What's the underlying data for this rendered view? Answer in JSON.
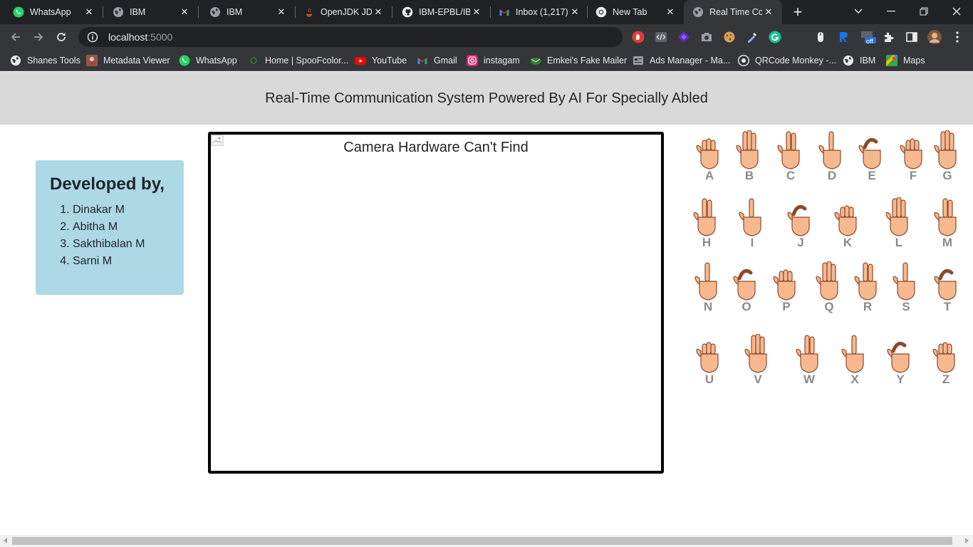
{
  "browser": {
    "tabs": [
      {
        "title": "WhatsApp",
        "icon": "whatsapp-icon"
      },
      {
        "title": "IBM",
        "icon": "globe-icon"
      },
      {
        "title": "IBM",
        "icon": "globe-icon"
      },
      {
        "title": "OpenJDK JDK",
        "icon": "java-icon"
      },
      {
        "title": "IBM-EPBL/IBM",
        "icon": "github-icon"
      },
      {
        "title": "Inbox (1,217)",
        "icon": "gmail-icon"
      },
      {
        "title": "New Tab",
        "icon": "chrome-icon"
      },
      {
        "title": "Real Time Com",
        "icon": "globe-icon"
      }
    ],
    "active_tab_index": 7,
    "address": {
      "host": "localhost",
      "port": ":5000"
    },
    "bookmarks": [
      {
        "label": "Shanes Tools",
        "icon": "globe-icon"
      },
      {
        "label": "Metadata Viewer",
        "icon": "metadata-viewer-icon"
      },
      {
        "label": "WhatsApp",
        "icon": "whatsapp-icon"
      },
      {
        "label": "Home | SpooFcolor...",
        "icon": "spoofcolor-icon"
      },
      {
        "label": "YouTube",
        "icon": "youtube-icon"
      },
      {
        "label": "Gmail",
        "icon": "gmail-icon"
      },
      {
        "label": "instagam",
        "icon": "instagram-icon"
      },
      {
        "label": "Emkei's Fake Mailer",
        "icon": "emkei-icon"
      },
      {
        "label": "Ads Manager - Ma...",
        "icon": "ads-manager-icon"
      },
      {
        "label": "QRCode Monkey -...",
        "icon": "qrcode-monkey-icon"
      },
      {
        "label": "IBM",
        "icon": "globe-icon"
      },
      {
        "label": "Maps",
        "icon": "maps-icon"
      }
    ],
    "extension_badge": "off"
  },
  "page": {
    "header_title": "Real-Time Communication System Powered By AI For Specially Abled",
    "developers": {
      "heading": "Developed by,",
      "names": [
        "Dinakar M",
        "Abitha M",
        "Sakthibalan M",
        "Sarni M"
      ]
    },
    "camera_alt_text": "Camera Hardware Can't Find",
    "asl_letters": [
      "A",
      "B",
      "C",
      "D",
      "E",
      "F",
      "G",
      "H",
      "I",
      "J",
      "K",
      "L",
      "M",
      "N",
      "O",
      "P",
      "Q",
      "R",
      "S",
      "T",
      "U",
      "V",
      "W",
      "X",
      "Y",
      "Z"
    ]
  },
  "colors": {
    "chrome_dark": "#202124",
    "chrome_toolbar": "#35363a",
    "header_bg": "#d9d9d9",
    "dev_card_bg": "#add8e6",
    "skin": "#f6b98f",
    "skin_outline": "#8b4a2b",
    "letter_gray": "#8a8a8a"
  }
}
